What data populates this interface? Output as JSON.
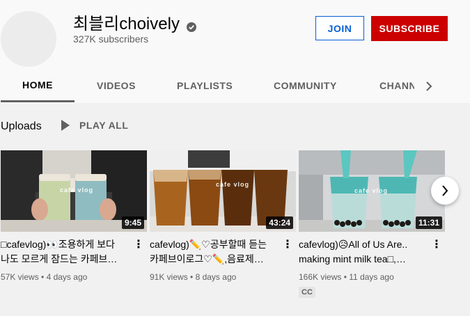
{
  "channel": {
    "name": "최블리choively",
    "subscribers": "327K subscribers",
    "join_label": "JOIN",
    "subscribe_label": "SUBSCRIBE",
    "verified_icon": "verified-check-icon"
  },
  "tabs": [
    "HOME",
    "VIDEOS",
    "PLAYLISTS",
    "COMMUNITY",
    "CHANNELS"
  ],
  "uploads": {
    "title": "Uploads",
    "play_all": "PLAY ALL"
  },
  "videos": [
    {
      "title": "□cafevlog)👀조용하게 보다 나도 모르게 잠드는 카페브…",
      "duration": "9:45",
      "views": "57K views",
      "age": "4 days ago",
      "overlay": "cafe vlog"
    },
    {
      "title": "cafevlog)✏️♡공부할때 듣는 카페브이로그♡✏️,음료제…",
      "duration": "43:24",
      "views": "91K views",
      "age": "8 days ago",
      "overlay": "cafe vlog"
    },
    {
      "title": "cafevlog)😥All of Us Are.. making mint milk tea□,…",
      "duration": "11:31",
      "views": "166K views",
      "age": "11 days ago",
      "overlay": "cafe vlog",
      "badge": "CC"
    }
  ],
  "colors": {
    "subscribe": "#cc0000",
    "join": "#065fd4"
  }
}
